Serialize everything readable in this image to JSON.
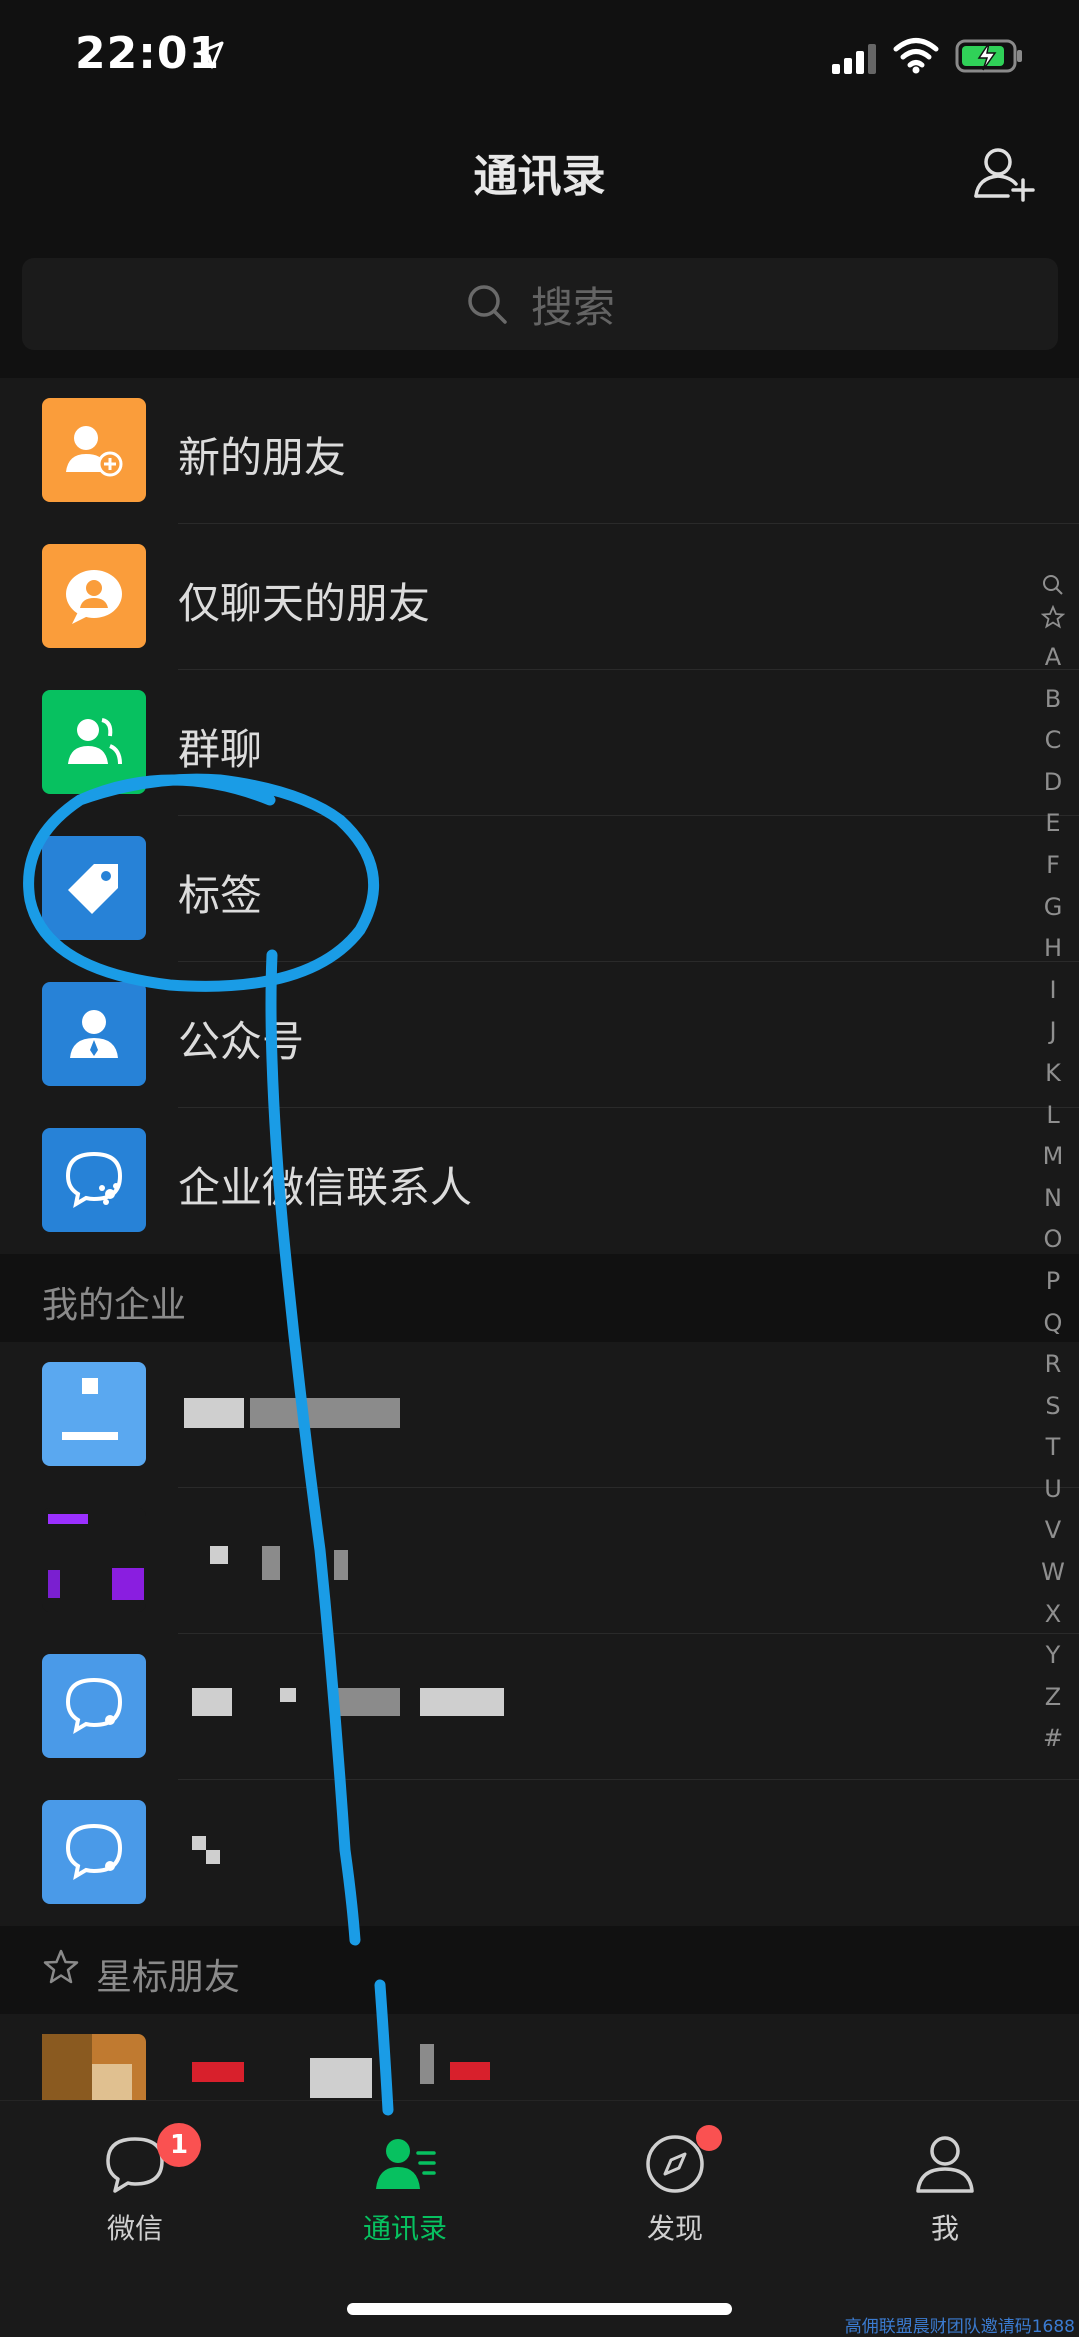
{
  "status_bar": {
    "time": "22:01"
  },
  "nav": {
    "title": "通讯录"
  },
  "search": {
    "placeholder": "搜索"
  },
  "functions": [
    {
      "label": "新的朋友",
      "icon": "add-friend-icon",
      "color": "#fa9d3b"
    },
    {
      "label": "仅聊天的朋友",
      "icon": "chat-only-friend-icon",
      "color": "#fa9d3b"
    },
    {
      "label": "群聊",
      "icon": "group-chat-icon",
      "color": "#07c160"
    },
    {
      "label": "标签",
      "icon": "tag-icon",
      "color": "#2782d7"
    },
    {
      "label": "公众号",
      "icon": "official-account-icon",
      "color": "#2782d7"
    },
    {
      "label": "企业微信联系人",
      "icon": "wecom-icon",
      "color": "#2782d7"
    }
  ],
  "sections": {
    "my_enterprise": "我的企业",
    "starred": "星标朋友"
  },
  "index_letters": [
    "A",
    "B",
    "C",
    "D",
    "E",
    "F",
    "G",
    "H",
    "I",
    "J",
    "K",
    "L",
    "M",
    "N",
    "O",
    "P",
    "Q",
    "R",
    "S",
    "T",
    "U",
    "V",
    "W",
    "X",
    "Y",
    "Z",
    "#"
  ],
  "tabs": [
    {
      "label": "微信",
      "icon": "chat-bubble-icon",
      "badge": "1"
    },
    {
      "label": "通讯录",
      "icon": "contacts-icon",
      "active": true
    },
    {
      "label": "发现",
      "icon": "compass-icon",
      "dot": true
    },
    {
      "label": "我",
      "icon": "profile-icon"
    }
  ],
  "colors": {
    "accent": "#07c160",
    "annotation": "#1a9ce6",
    "badge": "#fa5151"
  },
  "watermark": "高佣联盟晨财团队邀请码1688"
}
